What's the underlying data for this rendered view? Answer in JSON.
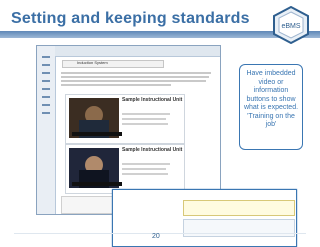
{
  "slide": {
    "title": "Setting and keeping standards",
    "page_number": "20",
    "callout": "Have imbedded video or information buttons to show what is expected. 'Training on the job'"
  },
  "logo": {
    "text": "eBMS",
    "color": "#2f5f8f"
  },
  "screenshot": {
    "section_label": "Induction System",
    "card1_title": "Sample Instructional Unit",
    "card2_title": "Sample Instructional Unit"
  },
  "colors": {
    "title": "#3b6fa5",
    "callout_border": "#3a76b2",
    "header_bar": "#6f93bb"
  }
}
